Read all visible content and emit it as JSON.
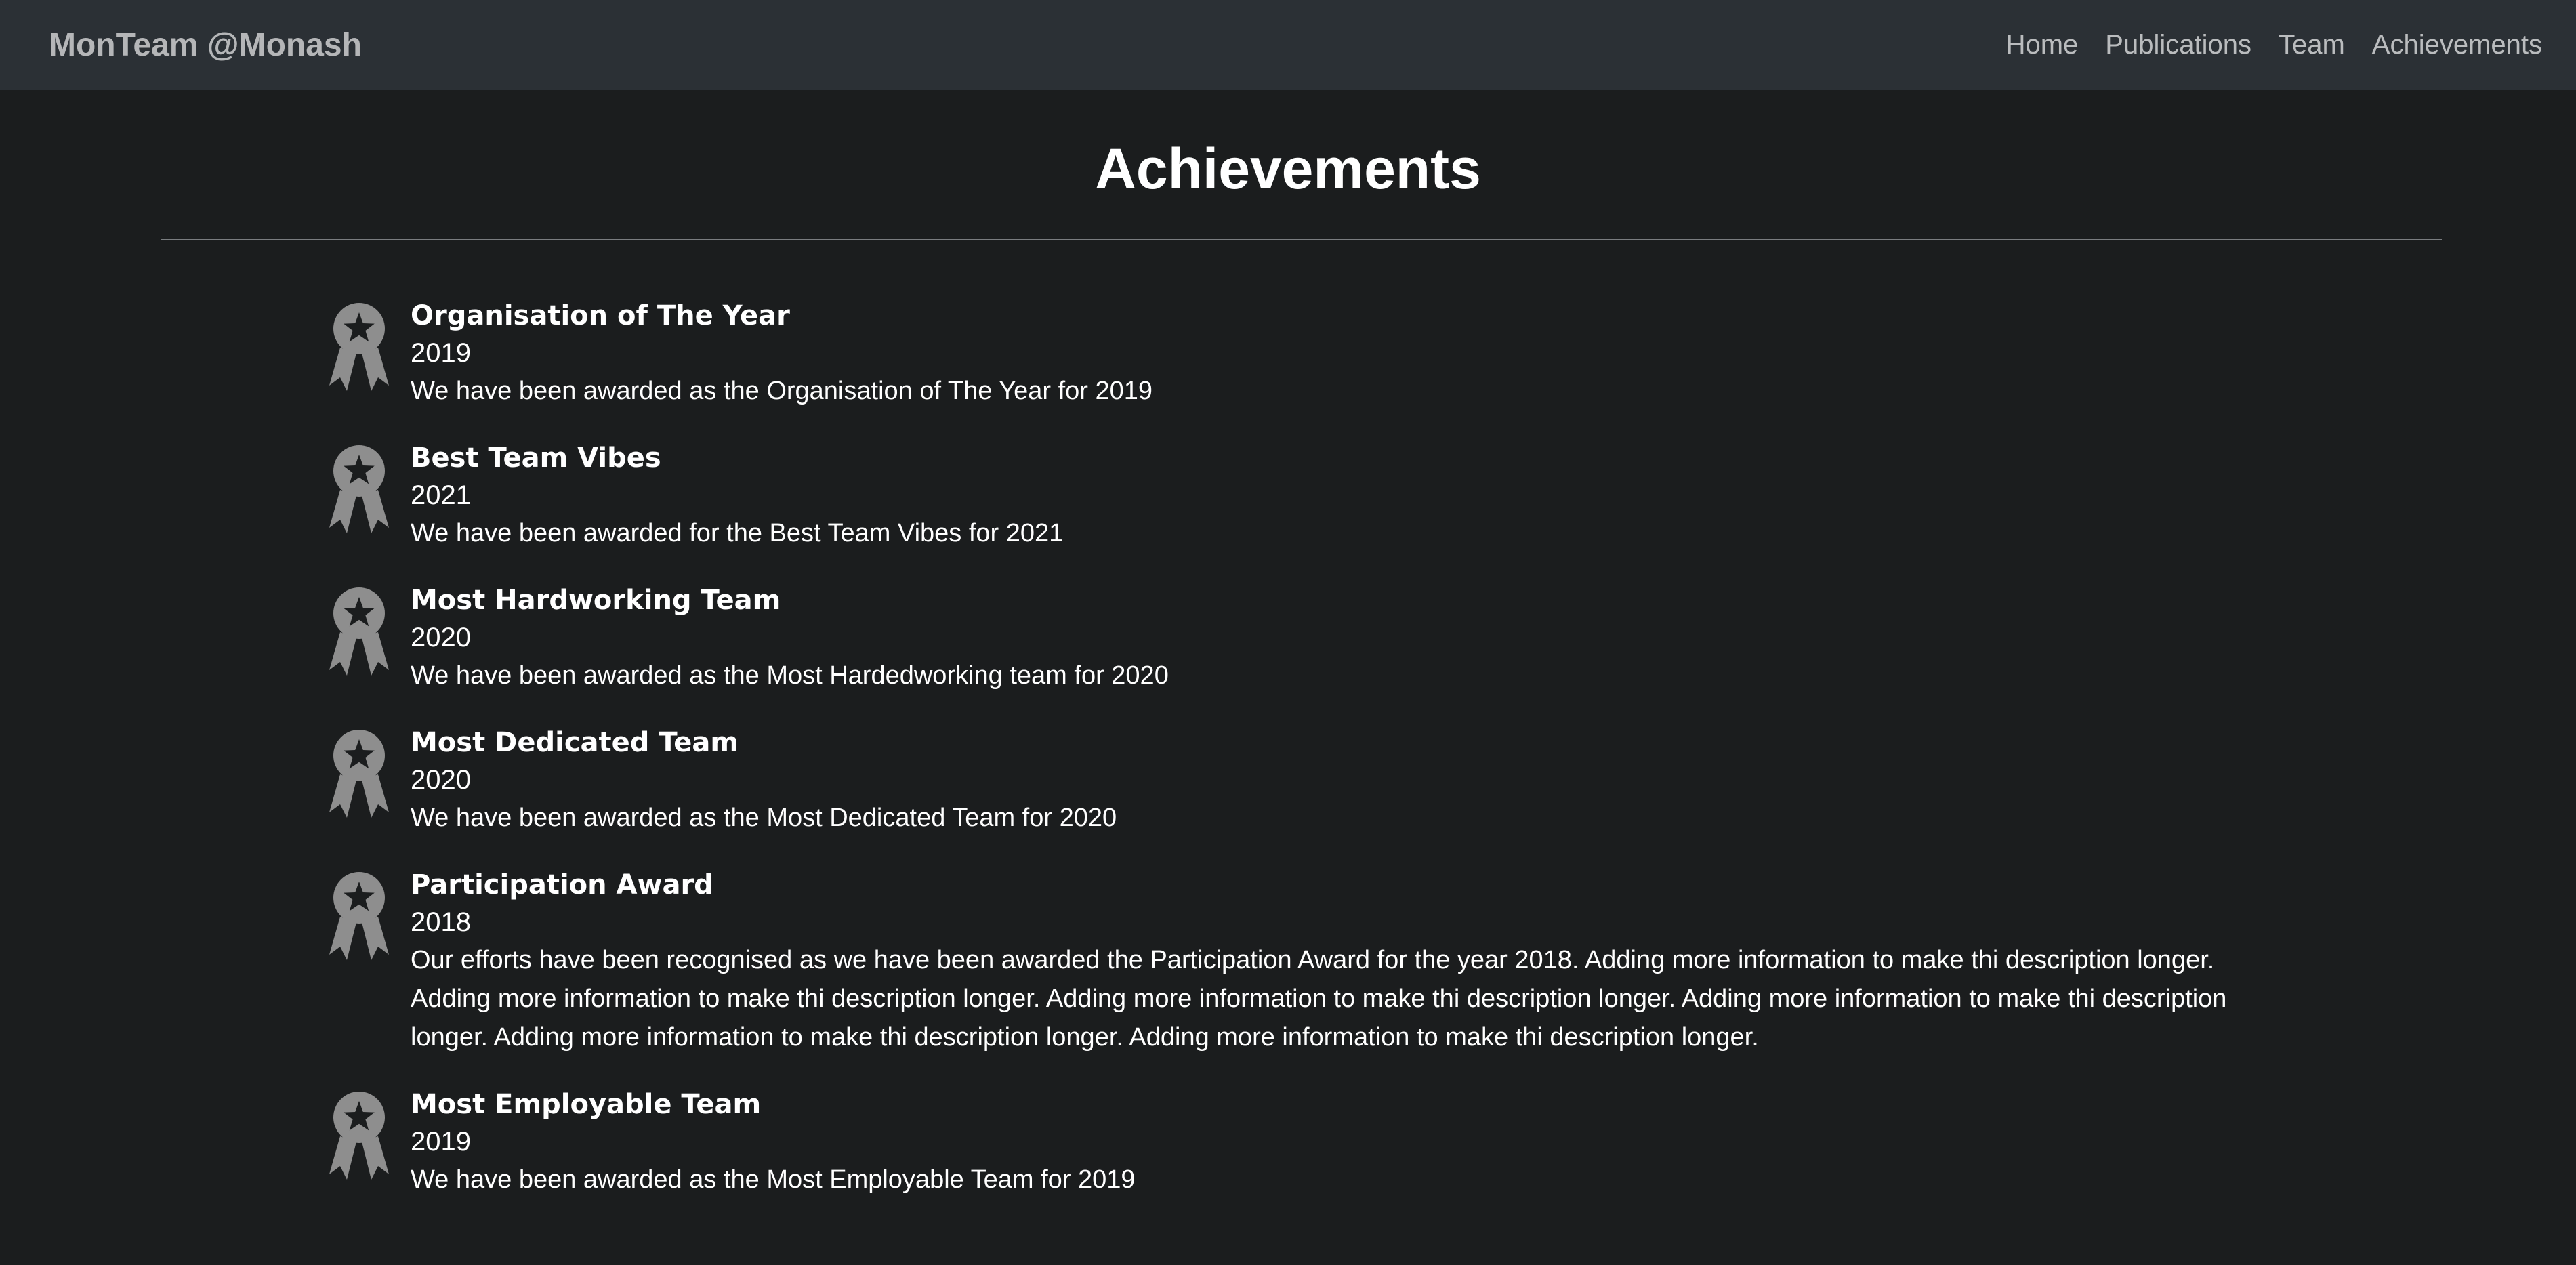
{
  "navbar": {
    "brand": "MonTeam @Monash",
    "links": [
      {
        "label": "Home"
      },
      {
        "label": "Publications"
      },
      {
        "label": "Team"
      },
      {
        "label": "Achievements"
      }
    ]
  },
  "main": {
    "title": "Achievements",
    "achievements": [
      {
        "icon": "award-ribbon-icon",
        "title": "Organisation of The Year",
        "year": "2019",
        "description": "We have been awarded as the Organisation of The Year for 2019"
      },
      {
        "icon": "award-ribbon-icon",
        "title": "Best Team Vibes",
        "year": "2021",
        "description": "We have been awarded for the Best Team Vibes for 2021"
      },
      {
        "icon": "award-ribbon-icon",
        "title": "Most Hardworking Team",
        "year": "2020",
        "description": "We have been awarded as the Most Hardedworking team for 2020"
      },
      {
        "icon": "award-ribbon-icon",
        "title": "Most Dedicated Team",
        "year": "2020",
        "description": "We have been awarded as the Most Dedicated Team for 2020"
      },
      {
        "icon": "award-ribbon-icon",
        "title": "Participation Award",
        "year": "2018",
        "description": "Our efforts have been recognised as we have been awarded the Participation Award for the year 2018. Adding more information to make thi description longer. Adding more information to make thi description longer. Adding more information to make thi description longer. Adding more information to make thi description longer. Adding more information to make thi description longer. Adding more information to make thi description longer."
      },
      {
        "icon": "award-ribbon-icon",
        "title": "Most Employable Team",
        "year": "2019",
        "description": "We have been awarded as the Most Employable Team for 2019"
      }
    ]
  },
  "colors": {
    "background": "#1b1d1e",
    "navbar": "#2b3035",
    "icon": "#8e8e8e",
    "text": "#ffffff"
  }
}
